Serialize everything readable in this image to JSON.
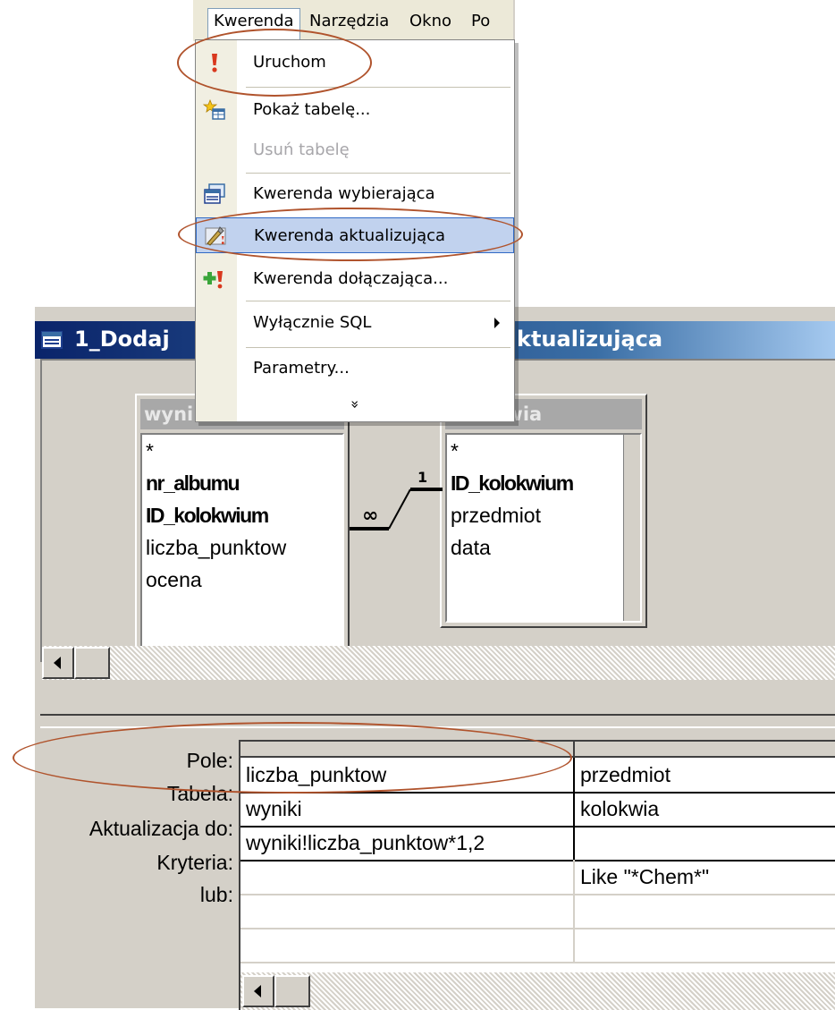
{
  "window": {
    "title_left": "1_Dodaj",
    "title_right": "ktualizująca"
  },
  "menu_bar": {
    "items": [
      "Kwerenda",
      "Narzędzia",
      "Okno",
      "Po"
    ]
  },
  "dropdown": {
    "items": [
      {
        "label": "Uruchom",
        "icon": "run-exclamation-icon",
        "enabled": true
      },
      {
        "label": "Pokaż tabelę...",
        "icon": "show-table-icon",
        "enabled": true
      },
      {
        "label": "Usuń tabelę",
        "icon": "",
        "enabled": false
      },
      {
        "label": "Kwerenda wybierająca",
        "icon": "select-query-icon",
        "enabled": true
      },
      {
        "label": "Kwerenda aktualizująca",
        "icon": "update-query-icon",
        "enabled": true,
        "highlighted": true
      },
      {
        "label": "Kwerenda dołączająca...",
        "icon": "append-query-icon",
        "enabled": true
      },
      {
        "label": "Wyłącznie SQL",
        "icon": "",
        "enabled": true,
        "submenu": true
      },
      {
        "label": "Parametry...",
        "icon": "",
        "enabled": true
      }
    ],
    "more_glyph": "»"
  },
  "tables": {
    "left": {
      "title": "wyniki",
      "fields": [
        "*",
        "nr_albumu",
        "ID_kolokwium",
        "liczba_punktow",
        "ocena"
      ],
      "keys": [
        false,
        true,
        true,
        false,
        false
      ]
    },
    "right": {
      "title": "kolokwia",
      "fields": [
        "*",
        "ID_kolokwium",
        "przedmiot",
        "data"
      ],
      "keys": [
        false,
        true,
        false,
        false
      ]
    },
    "relationship": {
      "many": "∞",
      "one": "1"
    }
  },
  "grid": {
    "row_labels": [
      "Pole:",
      "Tabela:",
      "Aktualizacja do:",
      "Kryteria:",
      "lub:"
    ],
    "columns": [
      {
        "Pole": "liczba_punktow",
        "Tabela": "wyniki",
        "Aktualizacja": "wyniki!liczba_punktow*1,2",
        "Kryteria": "",
        "lub": ""
      },
      {
        "Pole": "przedmiot",
        "Tabela": "kolokwia",
        "Aktualizacja": "",
        "Kryteria": "Like \"*Chem*\"",
        "lub": ""
      }
    ]
  },
  "colors": {
    "annotation": "#b0532c",
    "title_bar": "#0a246a",
    "menu_highlight": "#c1d2ee"
  }
}
